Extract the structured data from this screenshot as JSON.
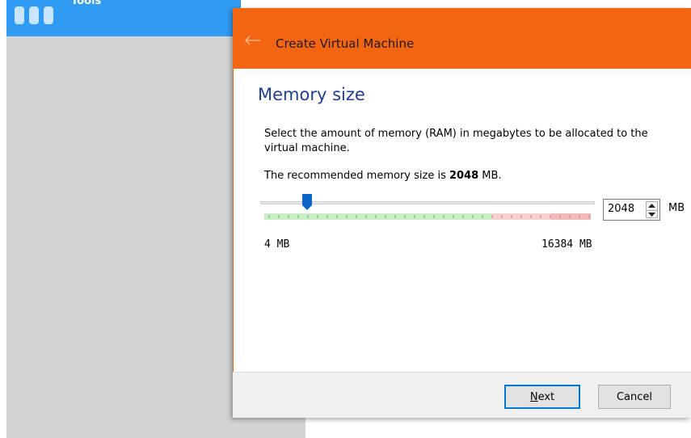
{
  "background": {
    "tools_label": "Tools",
    "tools_icon": "tools-icon",
    "colors": {
      "topbar": "#2f9bf2",
      "panel": "#d4d4d4"
    }
  },
  "dialog": {
    "title": "Create Virtual Machine",
    "back_icon": "back-arrow-icon",
    "heading": "Memory size",
    "description": "Select the amount of memory (RAM) in megabytes to be allocated to the virtual machine.",
    "recommend_prefix": "The recommended memory size is ",
    "recommend_value": "2048",
    "recommend_suffix": " MB.",
    "slider": {
      "min": 4,
      "max": 16384,
      "value": 2048
    },
    "scale_min_label": "4 MB",
    "scale_max_label": "16384 MB",
    "spin_value": "2048",
    "unit_label": "MB",
    "buttons": {
      "next_first": "N",
      "next_rest": "ext",
      "cancel": "Cancel"
    },
    "colors": {
      "title_bar": "#f46511",
      "heading": "#1f3d99",
      "accent": "#0078d7"
    }
  }
}
